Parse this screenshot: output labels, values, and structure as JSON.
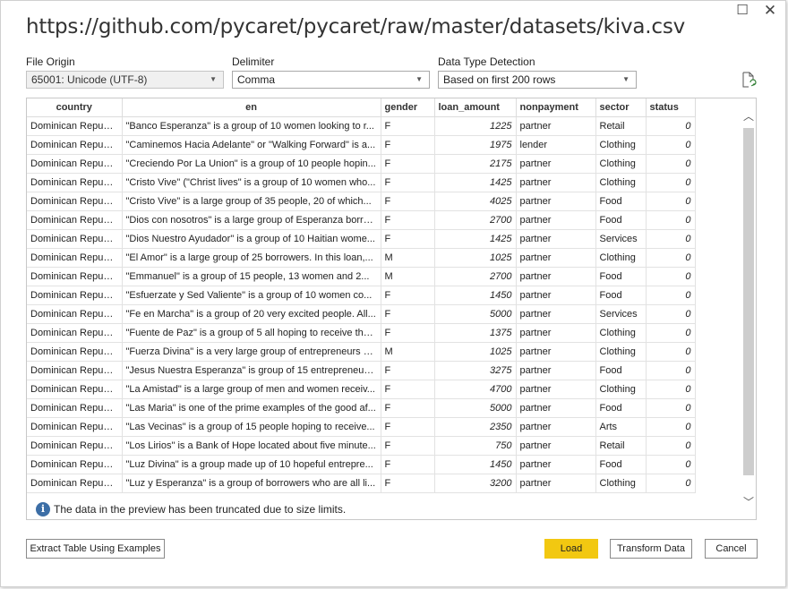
{
  "window": {
    "title": "https://github.com/pycaret/pycaret/raw/master/datasets/kiva.csv",
    "maximize_glyph": "☐",
    "close_glyph": "✕"
  },
  "options": {
    "file_origin_label": "File Origin",
    "file_origin_value": "65001: Unicode (UTF-8)",
    "delimiter_label": "Delimiter",
    "delimiter_value": "Comma",
    "detection_label": "Data Type Detection",
    "detection_value": "Based on first 200 rows"
  },
  "table": {
    "columns": [
      "country",
      "en",
      "gender",
      "loan_amount",
      "nonpayment",
      "sector",
      "status"
    ],
    "rows": [
      [
        "Dominican Republic",
        "\"Banco Esperanza\" is a group of 10 women looking to r...",
        "F",
        "1225",
        "partner",
        "Retail",
        "0"
      ],
      [
        "Dominican Republic",
        "\"Caminemos Hacia Adelante\" or \"Walking Forward\" is a...",
        "F",
        "1975",
        "lender",
        "Clothing",
        "0"
      ],
      [
        "Dominican Republic",
        "\"Creciendo Por La Union\" is a group of 10 people hopin...",
        "F",
        "2175",
        "partner",
        "Clothing",
        "0"
      ],
      [
        "Dominican Republic",
        "\"Cristo Vive\" (\"Christ lives\" is a group of 10 women who...",
        "F",
        "1425",
        "partner",
        "Clothing",
        "0"
      ],
      [
        "Dominican Republic",
        "\"Cristo Vive\" is a large group of 35 people, 20 of which...",
        "F",
        "4025",
        "partner",
        "Food",
        "0"
      ],
      [
        "Dominican Republic",
        "\"Dios con nosotros\" is a large group of Esperanza borro...",
        "F",
        "2700",
        "partner",
        "Food",
        "0"
      ],
      [
        "Dominican Republic",
        "\"Dios Nuestro Ayudador\" is a group of 10 Haitian wome...",
        "F",
        "1425",
        "partner",
        "Services",
        "0"
      ],
      [
        "Dominican Republic",
        "\"El Amor\" is a large group of 25 borrowers. In this loan,...",
        "M",
        "1025",
        "partner",
        "Clothing",
        "0"
      ],
      [
        "Dominican Republic",
        "\"Emmanuel\" is a group of 15 people, 13 women and 2...",
        "M",
        "2700",
        "partner",
        "Food",
        "0"
      ],
      [
        "Dominican Republic",
        "\"Esfuerzate y Sed Valiente\" is a group of 10 women co...",
        "F",
        "1450",
        "partner",
        "Food",
        "0"
      ],
      [
        "Dominican Republic",
        "\"Fe en Marcha\" is a group of 20 very excited people. All...",
        "F",
        "5000",
        "partner",
        "Services",
        "0"
      ],
      [
        "Dominican Republic",
        "\"Fuente de Paz\" is a group of 5 all hoping to receive the...",
        "F",
        "1375",
        "partner",
        "Clothing",
        "0"
      ],
      [
        "Dominican Republic",
        "\"Fuerza Divina\" is a very large group of entrepreneurs a...",
        "M",
        "1025",
        "partner",
        "Clothing",
        "0"
      ],
      [
        "Dominican Republic",
        "\"Jesus Nuestra Esperanza\" is group of 15 entrepreneurs...",
        "F",
        "3275",
        "partner",
        "Food",
        "0"
      ],
      [
        "Dominican Republic",
        "\"La Amistad\" is a large group of men and women receiv...",
        "F",
        "4700",
        "partner",
        "Clothing",
        "0"
      ],
      [
        "Dominican Republic",
        "\"Las Maria\" is one of the prime examples of the good af...",
        "F",
        "5000",
        "partner",
        "Food",
        "0"
      ],
      [
        "Dominican Republic",
        "\"Las Vecinas\" is a group of 15 people hoping to receive...",
        "F",
        "2350",
        "partner",
        "Arts",
        "0"
      ],
      [
        "Dominican Republic",
        "\"Los Lirios\" is a Bank of Hope located about five minute...",
        "F",
        "750",
        "partner",
        "Retail",
        "0"
      ],
      [
        "Dominican Republic",
        "\"Luz Divina\" is a group made up of 10 hopeful entrepre...",
        "F",
        "1450",
        "partner",
        "Food",
        "0"
      ],
      [
        "Dominican Republic",
        "\"Luz y Esperanza\" is a group of borrowers who are all li...",
        "F",
        "3200",
        "partner",
        "Clothing",
        "0"
      ]
    ]
  },
  "notice": {
    "icon_glyph": "i",
    "text": "The data in the preview has been truncated due to size limits."
  },
  "buttons": {
    "extract": "Extract Table Using Examples",
    "load": "Load",
    "transform": "Transform Data",
    "cancel": "Cancel"
  },
  "colors": {
    "primary_button": "#f2c811",
    "info_icon": "#3c6ea6"
  }
}
